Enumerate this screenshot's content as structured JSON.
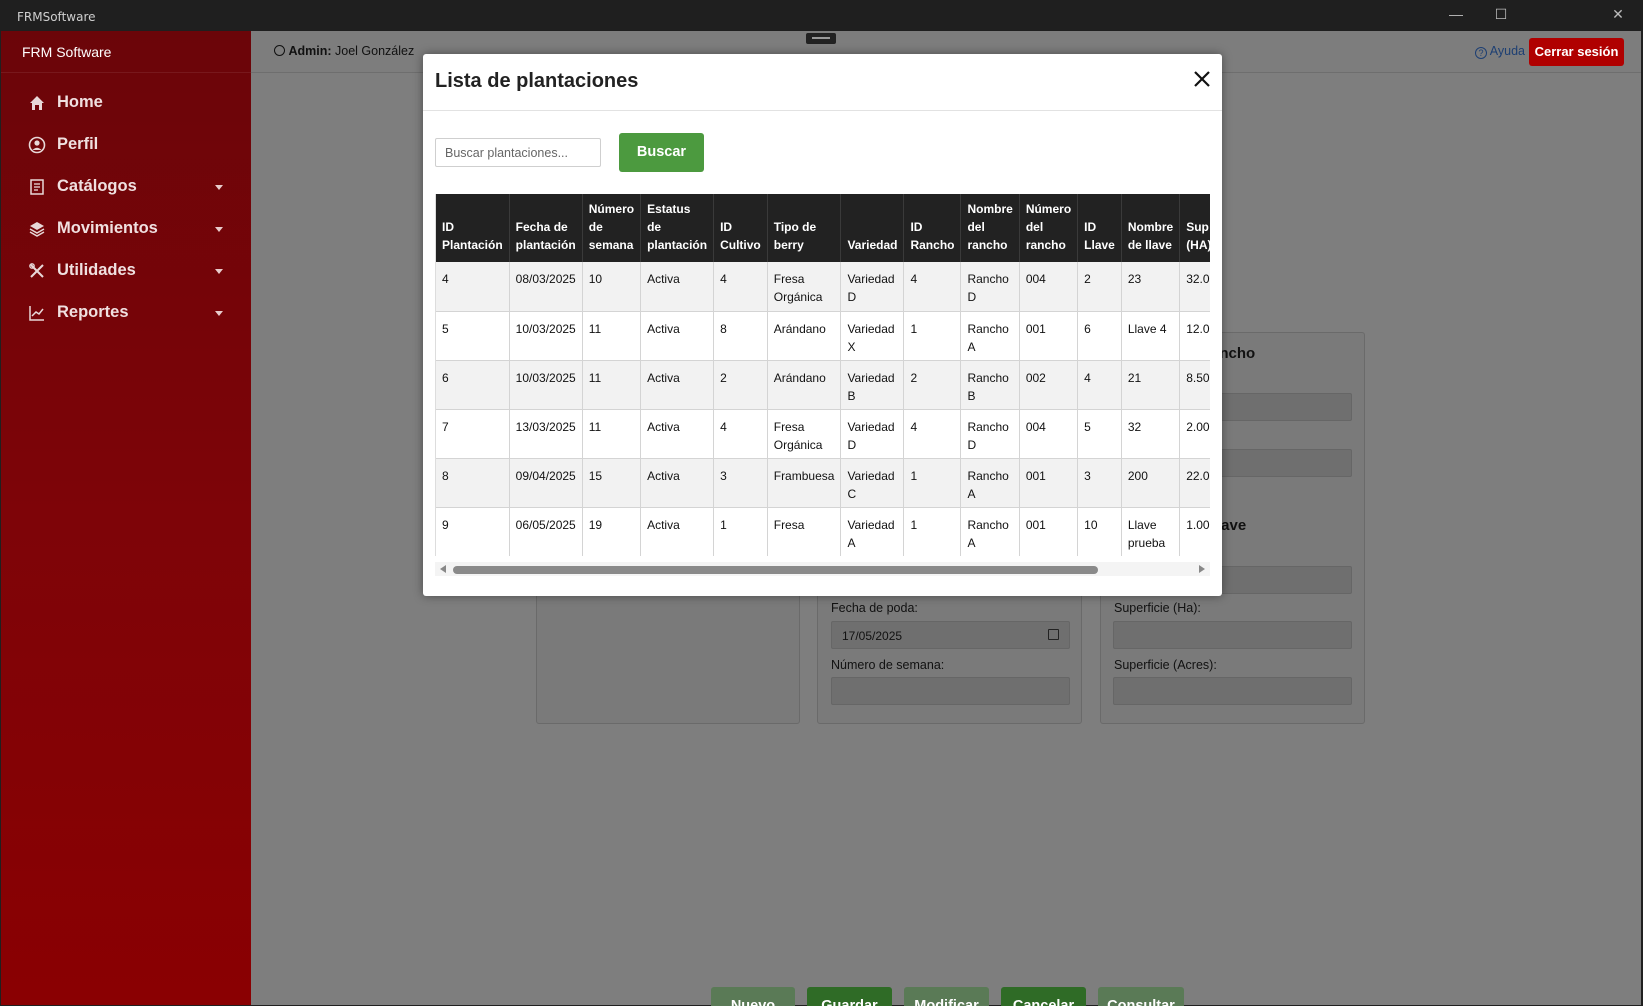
{
  "window": {
    "title": "FRMSoftware",
    "minimize": "—",
    "maximize": "☐",
    "close": "✕"
  },
  "sidebar": {
    "brand": "FRM Software",
    "items": [
      {
        "label": "Home",
        "icon": "home-icon",
        "has_caret": false
      },
      {
        "label": "Perfil",
        "icon": "user-circle-icon",
        "has_caret": false
      },
      {
        "label": "Catálogos",
        "icon": "catalog-icon",
        "has_caret": true
      },
      {
        "label": "Movimientos",
        "icon": "layers-icon",
        "has_caret": true
      },
      {
        "label": "Utilidades",
        "icon": "tools-icon",
        "has_caret": true
      },
      {
        "label": "Reportes",
        "icon": "chart-line-icon",
        "has_caret": true
      }
    ]
  },
  "header": {
    "admin_label": "Admin:",
    "admin_name": "Joel González",
    "help_label": "Ayuda",
    "logout_label": "Cerrar sesión"
  },
  "form": {
    "rancho_title": "ancho",
    "llave_title": "lave",
    "fecha_poda_label": "Fecha de poda:",
    "fecha_poda_value": "17/05/2025",
    "numero_semana_label": "Número de semana:",
    "superficie_ha_label": "Superficie (Ha):",
    "superficie_acres_label": "Superficie (Acres):"
  },
  "actions": {
    "nuevo": "Nuevo",
    "guardar": "Guardar",
    "modificar": "Modificar",
    "cancelar": "Cancelar",
    "consultar": "Consultar"
  },
  "modal": {
    "title": "Lista de plantaciones",
    "search_placeholder": "Buscar plantaciones...",
    "search_button": "Buscar",
    "columns": [
      "ID Plantación",
      "Fecha de plantación",
      "Número de semana",
      "Estatus de plantación",
      "ID Cultivo",
      "Tipo de berry",
      "Variedad",
      "ID Rancho",
      "Nombre del rancho",
      "Número del rancho",
      "ID Llave",
      "Nombre de llave",
      "Sup (HA)"
    ],
    "rows": [
      [
        "4",
        "08/03/2025",
        "10",
        "Activa",
        "4",
        "Fresa Orgánica",
        "Variedad D",
        "4",
        "Rancho D",
        "004",
        "2",
        "23",
        "32.0"
      ],
      [
        "5",
        "10/03/2025",
        "11",
        "Activa",
        "8",
        "Arándano",
        "Variedad X",
        "1",
        "Rancho A",
        "001",
        "6",
        "Llave 4",
        "12.0"
      ],
      [
        "6",
        "10/03/2025",
        "11",
        "Activa",
        "2",
        "Arándano",
        "Variedad B",
        "2",
        "Rancho B",
        "002",
        "4",
        "21",
        "8.50"
      ],
      [
        "7",
        "13/03/2025",
        "11",
        "Activa",
        "4",
        "Fresa Orgánica",
        "Variedad D",
        "4",
        "Rancho D",
        "004",
        "5",
        "32",
        "2.00"
      ],
      [
        "8",
        "09/04/2025",
        "15",
        "Activa",
        "3",
        "Frambuesa",
        "Variedad C",
        "1",
        "Rancho A",
        "001",
        "3",
        "200",
        "22.0"
      ],
      [
        "9",
        "06/05/2025",
        "19",
        "Activa",
        "1",
        "Fresa",
        "Variedad A",
        "1",
        "Rancho A",
        "001",
        "10",
        "Llave prueba",
        "1.00"
      ]
    ]
  },
  "colors": {
    "sidebar_top": "#6b0509",
    "sidebar_bottom": "#8a0002",
    "accent_green": "#4c9a3f",
    "logout_red": "#b00000",
    "table_header": "#222222"
  }
}
